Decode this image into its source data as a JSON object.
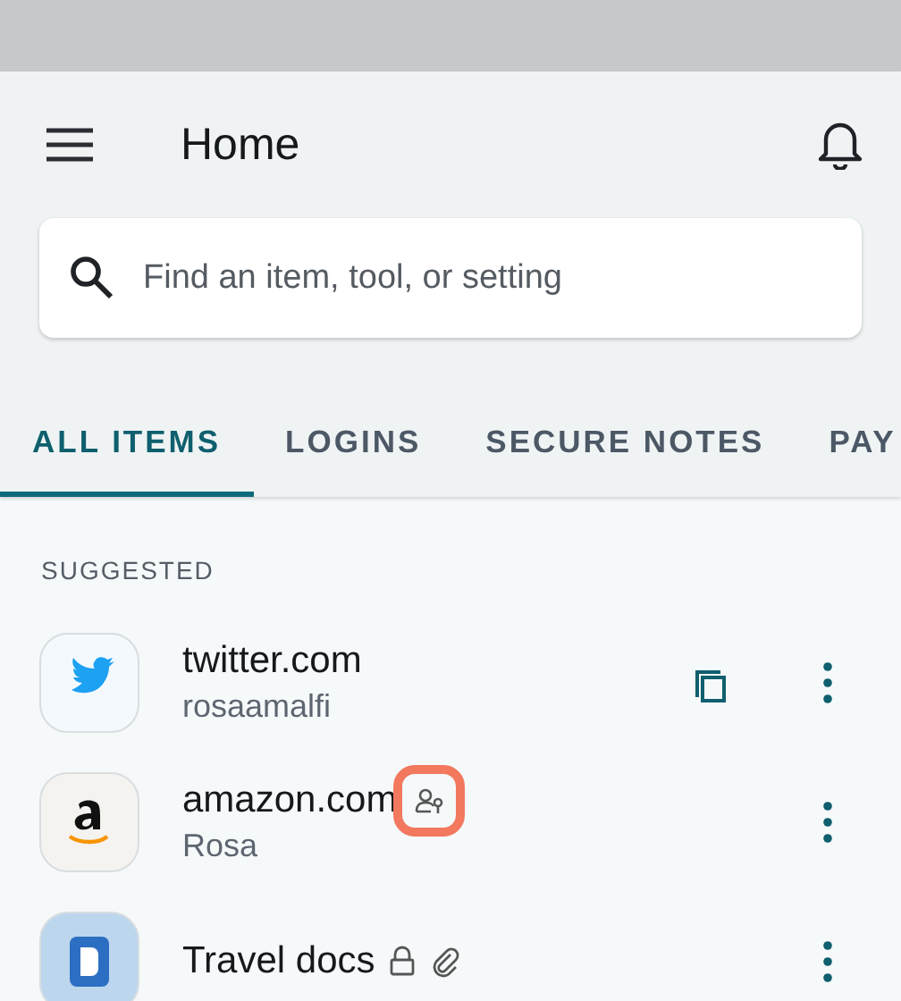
{
  "header": {
    "title": "Home"
  },
  "search": {
    "placeholder": "Find an item, tool, or setting"
  },
  "tabs": [
    {
      "label": "ALL ITEMS",
      "selected": true
    },
    {
      "label": "LOGINS",
      "selected": false
    },
    {
      "label": "SECURE NOTES",
      "selected": false
    },
    {
      "label": "PAY",
      "selected": false
    }
  ],
  "section": {
    "title": "SUGGESTED"
  },
  "items": [
    {
      "kind": "twitter",
      "title": "twitter.com",
      "subtitle": "rosaamalfi",
      "copy": true
    },
    {
      "kind": "amazon",
      "title": "amazon.com",
      "subtitle": "Rosa",
      "copy": false,
      "badges": [
        {
          "kind": "shared",
          "highlighted": true
        }
      ]
    },
    {
      "kind": "document",
      "title": "Travel docs",
      "copy": false,
      "badges": [
        {
          "kind": "lock",
          "highlighted": false
        },
        {
          "kind": "attachment",
          "highlighted": false
        }
      ]
    }
  ]
}
